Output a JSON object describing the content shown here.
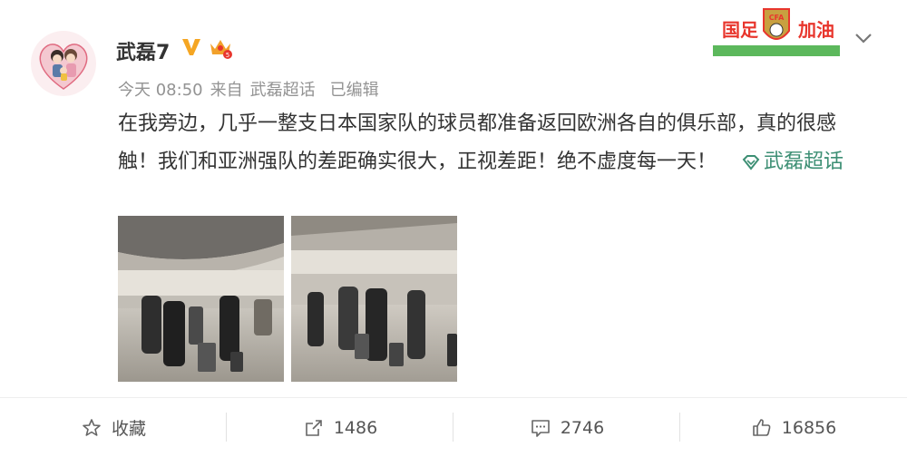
{
  "author": {
    "name": "武磊7",
    "avatar_icon": "family-cartoon-avatar"
  },
  "meta": {
    "time": "今天 08:50",
    "source_prefix": "来自",
    "source": "武磊超话",
    "edited": "已编辑"
  },
  "post": {
    "text": "在我旁边，几乎一整支日本国家队的球员都准备返回欧洲各自的俱乐部，真的很感触！我们和亚洲强队的差距确实很大，正视差距！绝不虚度每一天！",
    "topic_link": "武磊超话"
  },
  "banner": {
    "left_text": "国足",
    "right_text": "加油",
    "emblem_text": "CFA"
  },
  "actions": {
    "favorite_label": "收藏",
    "repost_count": "1486",
    "comment_count": "2746",
    "like_count": "16856"
  },
  "colors": {
    "verified_badge": "#f5a623",
    "topic_link": "#3d8f74",
    "meta_text": "#939393",
    "banner_red": "#e8362d",
    "banner_green": "#5cb85c"
  }
}
